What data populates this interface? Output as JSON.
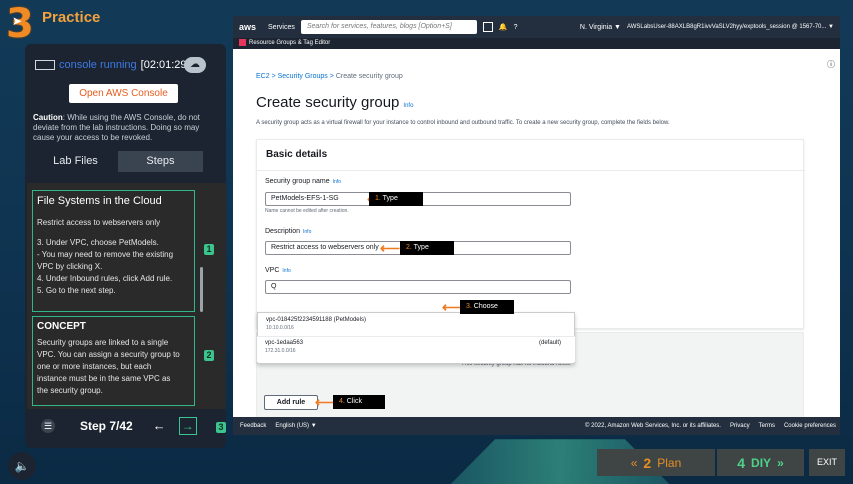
{
  "app": {
    "title": "Practice",
    "logo": "3"
  },
  "status": {
    "text": "console running",
    "time": "[02:01:29]"
  },
  "open_console": "Open AWS Console",
  "caution": {
    "bold": "Caution",
    "text": ": While using the AWS Console, do not deviate from the lab instructions. Doing so may cause your access to be revoked."
  },
  "tabs": [
    "Lab Files",
    "Steps"
  ],
  "step_box": {
    "title": "File Systems in the Cloud",
    "line1": "Restrict access to webservers only",
    "line2": "3. Under VPC, choose PetModels.",
    "line3": "- You may need to remove the existing",
    "line4": "VPC by clicking X.",
    "line5": "4. Under Inbound rules, click Add rule.",
    "line6": "5. Go to the next step.",
    "marker": "1"
  },
  "concept": {
    "title": "CONCEPT",
    "text1": "Security groups are linked to a single",
    "text2": "VPC.  You can assign a security group to",
    "text3": "one or more instances, but each",
    "text4": "instance must be in the same VPC as",
    "text5": "the security group.",
    "marker": "2"
  },
  "nav": {
    "menu_icon": "☰",
    "step": "Step 7/42",
    "prev": "←",
    "next": "→",
    "marker": "3"
  },
  "aws": {
    "logo": "aws",
    "services": "Services",
    "search_placeholder": "Search for services, features, blogs [Option+S]",
    "region": "N. Virginia ▼",
    "account": "AWSLabsUser-88AXLB8gR1ivvVaSLV2hyy/exptools_session @ 1567-70... ▼",
    "subbar": "Resource Groups & Tag Editor",
    "breadcrumb": [
      "EC2",
      ">",
      "Security Groups",
      ">",
      "Create security group"
    ],
    "title": "Create security group",
    "info": "Info",
    "description": "A security group acts as a virtual firewall for your instance to control inbound and outbound traffic. To create a new security group, complete the fields below.",
    "panel_title": "Basic details",
    "sg_name_label": "Security group name",
    "sg_name_value": "PetModels-EFS-1-SG",
    "sg_name_hint": "Name cannot be edited after creation.",
    "desc_label": "Description",
    "desc_value": "Restrict access to webservers only",
    "vpc_label": "VPC",
    "vpc_search": "Q",
    "vpc_opt1": "vpc-018425f2234591188 (PetModels)",
    "vpc_opt1_cidr": "10.10.0.0/16",
    "vpc_opt2": "vpc-1edaa563",
    "vpc_opt2_cidr": "172.31.0.0/16",
    "vpc_opt2_default": "(default)",
    "no_rules": "This security group has no inbound rules.",
    "add_rule": "Add rule",
    "footer": {
      "feedback": "Feedback",
      "lang": "English (US) ▼",
      "copyright": "© 2022, Amazon Web Services, Inc. or its affiliates.",
      "privacy": "Privacy",
      "terms": "Terms",
      "cookies": "Cookie preferences"
    }
  },
  "callouts": {
    "c1": {
      "num": "1.",
      "text": " Type"
    },
    "c2": {
      "num": "2.",
      "text": " Type"
    },
    "c3": {
      "num": "3.",
      "text": " Choose"
    },
    "c4": {
      "num": "4.",
      "text": " Click"
    }
  },
  "bottom": {
    "plan_num": "2",
    "plan": "Plan",
    "plan_arrow": "«",
    "diy_num": "4",
    "diy": "DIY",
    "diy_arrow": "»",
    "exit": "EXIT"
  },
  "colors": {
    "accent_orange": "#f08a24",
    "accent_green": "#3cc48e",
    "aws_dark": "#232f3e",
    "link_blue": "#0972d3"
  }
}
